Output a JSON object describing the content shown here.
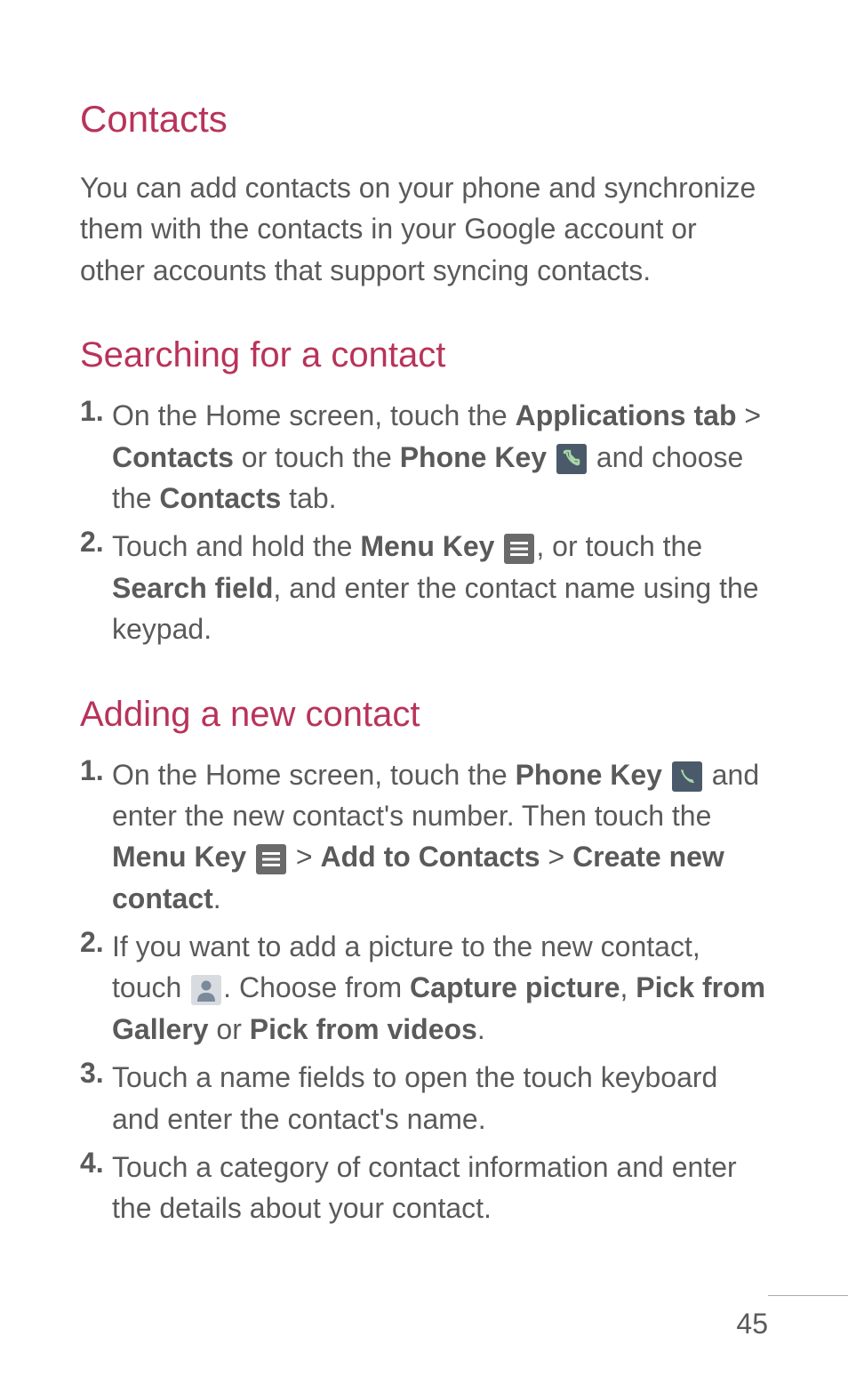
{
  "contacts": {
    "heading": "Contacts",
    "intro": "You can add contacts on your phone and synchronize them with the contacts in your Google account or other accounts that support syncing contacts."
  },
  "searching": {
    "heading": "Searching for a contact",
    "step1": {
      "num": "1.",
      "a": " On the Home screen, touch the ",
      "b": "Applications tab",
      "c": " > ",
      "d": "Contacts",
      "e": " or touch the ",
      "f": "Phone Key",
      "g": " ",
      "h": " and choose the ",
      "i": "Contacts",
      "j": " tab."
    },
    "step2": {
      "num": "2.",
      "a": " Touch and hold the ",
      "b": "Menu Key",
      "c": " ",
      "d": ", or touch the ",
      "e": "Search field",
      "f": ", and enter the contact name using the keypad."
    }
  },
  "adding": {
    "heading": "Adding a new contact",
    "step1": {
      "num": "1.",
      "a": " On the Home screen, touch the ",
      "b": "Phone Key",
      "c": " ",
      "d": " and enter the new contact's number. Then touch the ",
      "e": "Menu Key",
      "f": " ",
      "g": " > ",
      "h": "Add to Contacts",
      "i": " > ",
      "j": "Create new contact",
      "k": "."
    },
    "step2": {
      "num": "2.",
      "a": " If you want to add a picture to the new contact, touch ",
      "b": ". Choose from ",
      "c": "Capture picture",
      "d": ", ",
      "e": "Pick from Gallery",
      "f": " or ",
      "g": "Pick from videos",
      "h": "."
    },
    "step3": {
      "num": "3.",
      "a": " Touch a name fields to open the touch keyboard and enter the contact's name."
    },
    "step4": {
      "num": "4.",
      "a": " Touch a category of contact information and enter the details about your contact."
    }
  },
  "page": "45"
}
